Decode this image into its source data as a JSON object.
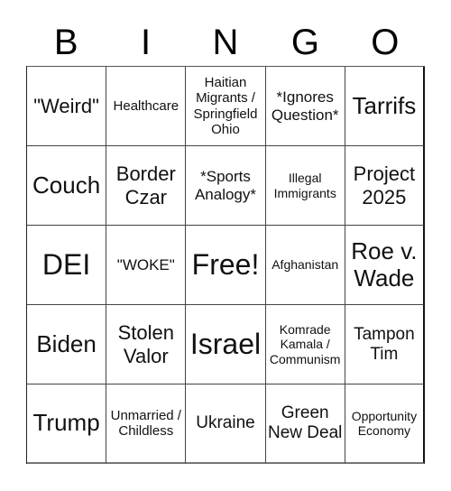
{
  "header": {
    "letters": [
      "B",
      "I",
      "N",
      "G",
      "O"
    ]
  },
  "board": {
    "cells": [
      {
        "text": "\"Weird\"",
        "size": "s-md"
      },
      {
        "text": "Healthcare",
        "size": "s-xs"
      },
      {
        "text": "Haitian Migrants / Springfield Ohio",
        "size": "s-xs"
      },
      {
        "text": "*Ignores Question*",
        "size": "s-sm"
      },
      {
        "text": "Tarrifs",
        "size": "s-lg"
      },
      {
        "text": "Couch",
        "size": "s-lg"
      },
      {
        "text": "Border Czar",
        "size": "s-md"
      },
      {
        "text": "*Sports Analogy*",
        "size": "s-sm"
      },
      {
        "text": "Illegal Immigrants",
        "size": "s-xxs"
      },
      {
        "text": "Project 2025",
        "size": "s-md"
      },
      {
        "text": "DEI",
        "size": "s-xl"
      },
      {
        "text": "\"WOKE\"",
        "size": "s-sm"
      },
      {
        "text": "Free!",
        "size": "s-xl"
      },
      {
        "text": "Afghanistan",
        "size": "s-xxs"
      },
      {
        "text": "Roe v. Wade",
        "size": "s-lg"
      },
      {
        "text": "Biden",
        "size": "s-lg"
      },
      {
        "text": "Stolen Valor",
        "size": "s-md"
      },
      {
        "text": "Israel",
        "size": "s-xl"
      },
      {
        "text": "Komrade Kamala / Communism",
        "size": "s-xxs"
      },
      {
        "text": "Tampon Tim",
        "size": "s-mdn"
      },
      {
        "text": "Trump",
        "size": "s-lg"
      },
      {
        "text": "Unmarried / Childless",
        "size": "s-xs"
      },
      {
        "text": "Ukraine",
        "size": "s-mdn"
      },
      {
        "text": "Green New Deal",
        "size": "s-mdn"
      },
      {
        "text": "Opportunity Economy",
        "size": "s-xxs"
      }
    ]
  }
}
